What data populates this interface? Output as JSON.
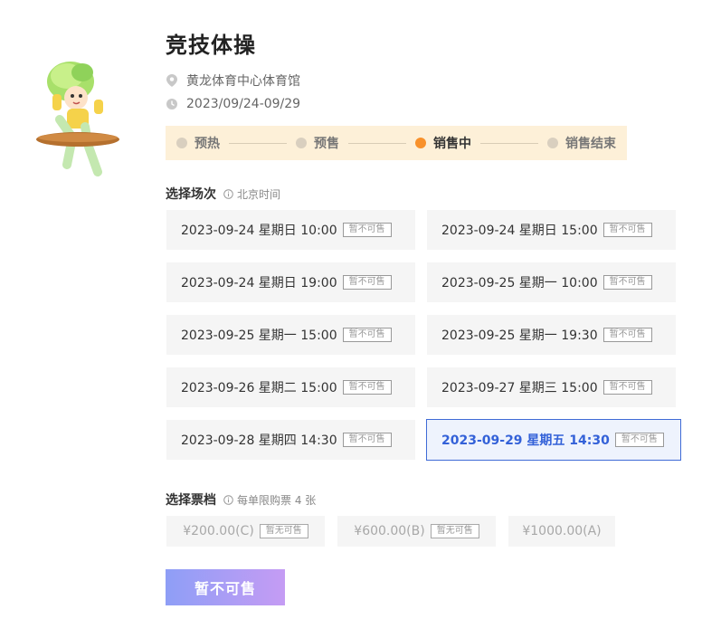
{
  "event": {
    "title": "竞技体操",
    "venue": "黄龙体育中心体育馆",
    "dates": "2023/09/24-09/29"
  },
  "stepper": [
    {
      "label": "预热",
      "active": false
    },
    {
      "label": "预售",
      "active": false
    },
    {
      "label": "销售中",
      "active": true
    },
    {
      "label": "销售结束",
      "active": false
    }
  ],
  "sessions_section": {
    "label": "选择场次",
    "hint": "北京时间"
  },
  "sessions": [
    {
      "datetime": "2023-09-24 星期日 10:00",
      "badge": "暂不可售"
    },
    {
      "datetime": "2023-09-24 星期日 15:00",
      "badge": "暂不可售"
    },
    {
      "datetime": "2023-09-24 星期日 19:00",
      "badge": "暂不可售"
    },
    {
      "datetime": "2023-09-25 星期一 10:00",
      "badge": "暂不可售"
    },
    {
      "datetime": "2023-09-25 星期一 15:00",
      "badge": "暂不可售"
    },
    {
      "datetime": "2023-09-25 星期一 19:30",
      "badge": "暂不可售"
    },
    {
      "datetime": "2023-09-26 星期二 15:00",
      "badge": "暂不可售"
    },
    {
      "datetime": "2023-09-27 星期三 15:00",
      "badge": "暂不可售"
    },
    {
      "datetime": "2023-09-28 星期四 14:30",
      "badge": "暂不可售"
    },
    {
      "datetime": "2023-09-29 星期五 14:30",
      "badge": "暂不可售",
      "selected": true
    }
  ],
  "tickets_section": {
    "label": "选择票档",
    "hint": "每单限购票 4 张"
  },
  "tickets": [
    {
      "price": "¥200.00(C)",
      "badge": "暂无可售"
    },
    {
      "price": "¥600.00(B)",
      "badge": "暂无可售"
    },
    {
      "price": "¥1000.00(A)",
      "badge": ""
    }
  ],
  "buy_button": {
    "label": "暂不可售"
  },
  "colors": {
    "accent": "#3361d8",
    "active_step": "#f8912b",
    "stepper_bg": "#fdf0d8"
  }
}
